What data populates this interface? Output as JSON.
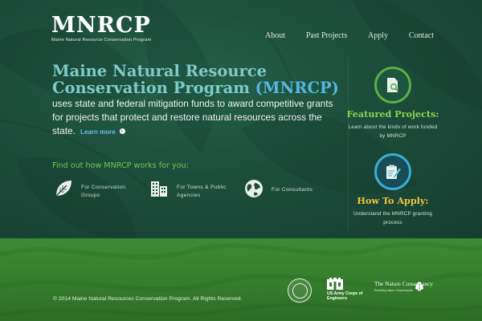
{
  "logo": {
    "wordmark": "MNRCP",
    "subtitle": "Maine Natural Resource Conservation Program"
  },
  "nav": {
    "items": [
      "About",
      "Past Projects",
      "Apply",
      "Contact"
    ]
  },
  "hero": {
    "title_line1": "Maine Natural Resource",
    "title_line2": "Conservation Program",
    "title_abbr": "(MNRCP)",
    "description": "uses state and federal mitigation funds to award competitive grants for projects that protect and restore natural resources across the state.",
    "learn_more": "Learn more"
  },
  "find_out": {
    "heading": "Find out how MNRCP works for you:",
    "items": [
      {
        "label": "For Conservation Groups",
        "icon": "leaf-icon"
      },
      {
        "label": "For Towns & Public Agencies",
        "icon": "buildings-icon"
      },
      {
        "label": "For Consultants",
        "icon": "globe-icon"
      }
    ]
  },
  "features": [
    {
      "title": "Featured Projects:",
      "description": "Learn about the kinds of work funded by MNRCP",
      "icon": "document-magnifier-icon"
    },
    {
      "title": "How To Apply:",
      "description": "Understand the MNRCP granting process",
      "icon": "clipboard-pencil-icon"
    }
  ],
  "footer": {
    "copyright": "© 2014 Maine Natural Resources Conservation Program. All Rights Reserved.",
    "partners": {
      "usace": "US Army Corps of Engineers",
      "tnc_name": "The Nature Conservancy",
      "tnc_tagline": "Protecting nature. Preserving life."
    }
  },
  "colors": {
    "background_dark": "#1d4c3a",
    "footer_green": "#3e8b34",
    "title_teal": "#7dcbc7",
    "abbr_blue": "#55b7e0",
    "accent_green": "#71c84f",
    "featured_title": "#8ad252",
    "apply_title": "#f0c43f"
  }
}
